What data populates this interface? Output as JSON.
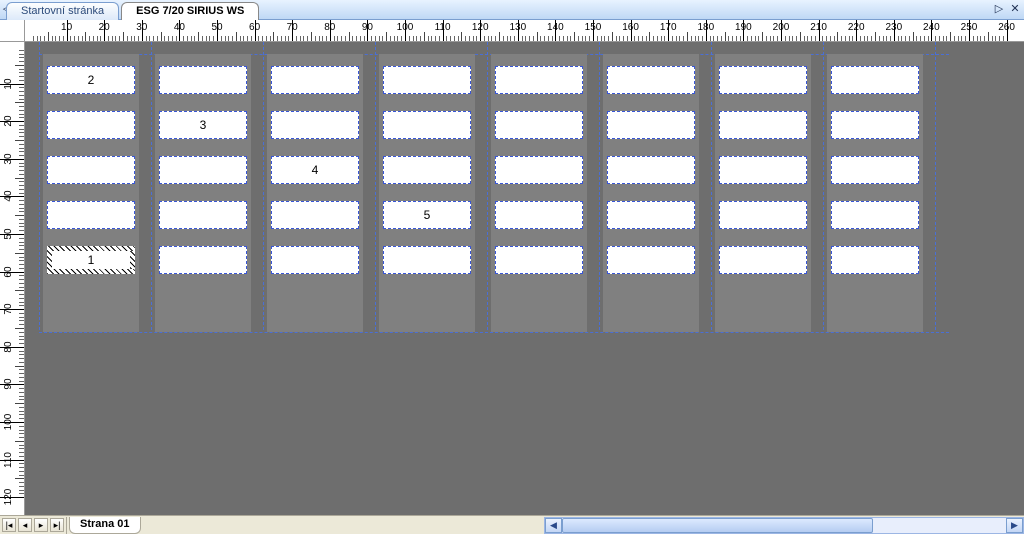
{
  "tabs": {
    "inactive": "Startovní stránka",
    "active": "ESG 7/20 SIRIUS WS"
  },
  "h_ruler": [
    "10",
    "20",
    "30",
    "40",
    "50",
    "60",
    "70",
    "80",
    "90",
    "100",
    "110",
    "120",
    "130",
    "140",
    "150",
    "160",
    "170",
    "180",
    "190",
    "200",
    "210",
    "220",
    "230",
    "240",
    "250",
    "260"
  ],
  "v_ruler": [
    "10",
    "20",
    "30",
    "40",
    "50",
    "60",
    "70",
    "80",
    "90",
    "100",
    "110",
    "120"
  ],
  "columns": 8,
  "rows": 5,
  "labels": {
    "c0r0": "2",
    "c1r1": "3",
    "c2r2": "4",
    "c3r3": "5",
    "c0r4": "1"
  },
  "selected": {
    "col": 0,
    "row": 4
  },
  "page_tab": "Strana 01"
}
